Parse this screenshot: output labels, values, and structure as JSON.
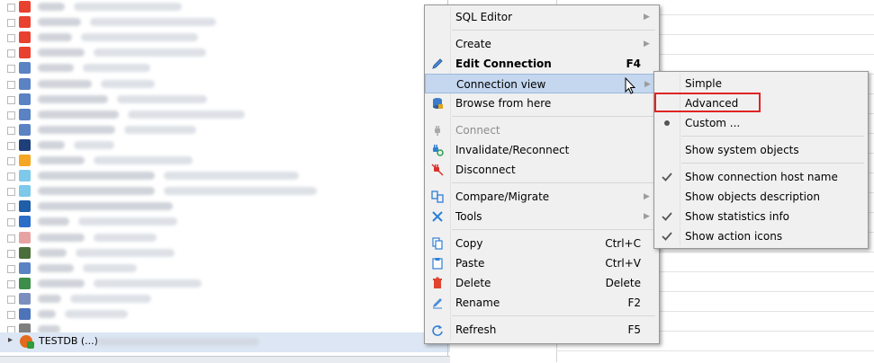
{
  "tree": {
    "rows": [
      {
        "icon_color": "#e8412f",
        "w1": 30,
        "w2": 120
      },
      {
        "icon_color": "#e8412f",
        "w1": 48,
        "w2": 140
      },
      {
        "icon_color": "#e8412f",
        "w1": 38,
        "w2": 130
      },
      {
        "icon_color": "#e8412f",
        "w1": 52,
        "w2": 125
      },
      {
        "icon_color": "#5b82c2",
        "w1": 40,
        "w2": 75
      },
      {
        "icon_color": "#5b82c2",
        "w1": 60,
        "w2": 60
      },
      {
        "icon_color": "#5b82c2",
        "w1": 78,
        "w2": 100
      },
      {
        "icon_color": "#5b82c2",
        "w1": 90,
        "w2": 130
      },
      {
        "icon_color": "#5b82c2",
        "w1": 86,
        "w2": 80
      },
      {
        "icon_color": "#1f3f7a",
        "w1": 30,
        "w2": 45
      },
      {
        "icon_color": "#f5a623",
        "w1": 52,
        "w2": 110
      },
      {
        "icon_color": "#7ec8ea",
        "w1": 130,
        "w2": 150
      },
      {
        "icon_color": "#7ec8ea",
        "w1": 130,
        "w2": 170
      },
      {
        "icon_color": "#1f5ea8",
        "w1": 150,
        "w2": 0
      },
      {
        "icon_color": "#2a6ec8",
        "w1": 35,
        "w2": 110
      },
      {
        "icon_color": "#e7a3a3",
        "w1": 52,
        "w2": 70
      },
      {
        "icon_color": "#4b6f3a",
        "w1": 32,
        "w2": 110
      },
      {
        "icon_color": "#5b82c2",
        "w1": 40,
        "w2": 60
      },
      {
        "icon_color": "#3c8e4a",
        "w1": 52,
        "w2": 120
      },
      {
        "icon_color": "#7b8fbf",
        "w1": 26,
        "w2": 90
      },
      {
        "icon_color": "#4d74b8",
        "w1": 20,
        "w2": 70
      },
      {
        "icon_color": "#7f7f7f",
        "w1": 25,
        "w2": 0
      }
    ],
    "selected_label": "TESTDB (...)"
  },
  "context_menu": {
    "sql_editor": "SQL Editor",
    "create": "Create",
    "edit_connection": "Edit Connection",
    "edit_connection_shortcut": "F4",
    "connection_view": "Connection view",
    "browse_from_here": "Browse from here",
    "connect": "Connect",
    "invalidate_reconnect": "Invalidate/Reconnect",
    "disconnect": "Disconnect",
    "compare_migrate": "Compare/Migrate",
    "tools": "Tools",
    "copy": "Copy",
    "copy_shortcut": "Ctrl+C",
    "paste": "Paste",
    "paste_shortcut": "Ctrl+V",
    "delete": "Delete",
    "delete_shortcut": "Delete",
    "rename": "Rename",
    "rename_shortcut": "F2",
    "refresh": "Refresh",
    "refresh_shortcut": "F5"
  },
  "submenu": {
    "simple": "Simple",
    "advanced": "Advanced",
    "custom": "Custom ...",
    "show_system_objects": "Show system objects",
    "show_connection_host_name": "Show connection host name",
    "show_objects_description": "Show objects description",
    "show_statistics_info": "Show statistics info",
    "show_action_icons": "Show action icons"
  },
  "colors": {
    "highlight": "#c4d7ee",
    "annotation_box": "#e02424",
    "menu_bg": "#f0f0f0"
  }
}
